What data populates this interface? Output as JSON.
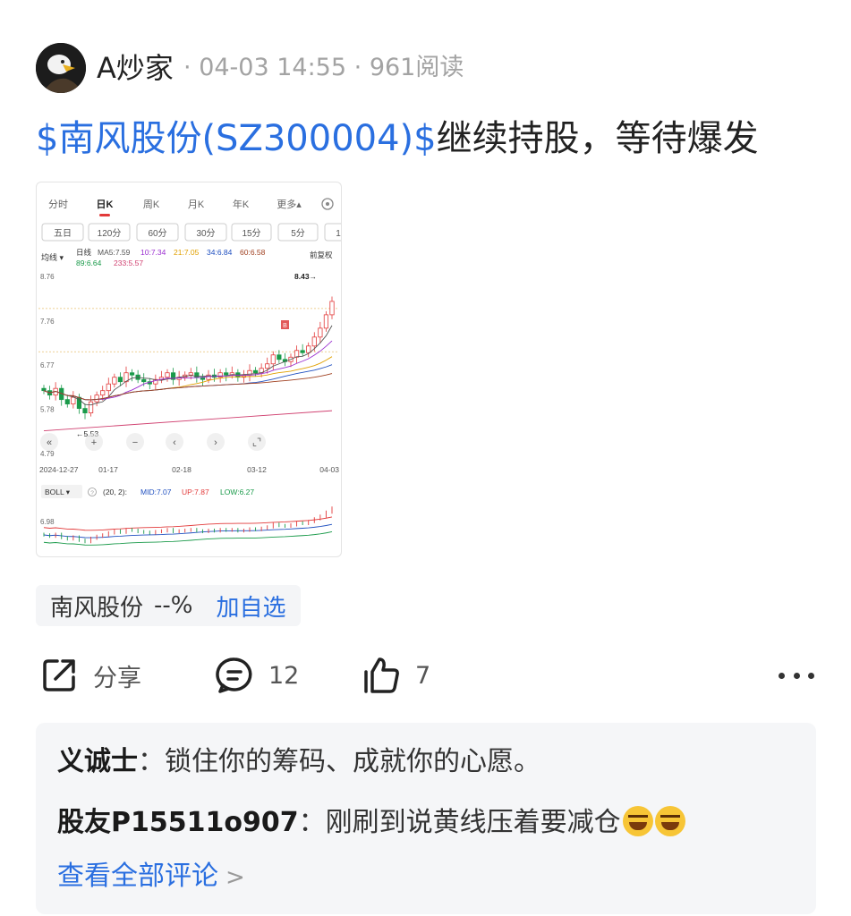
{
  "post": {
    "author": "A炒家",
    "date": "04-03 14:55",
    "reads": "961阅读",
    "separator": "·",
    "title_stock": "$南风股份(SZ300004)$",
    "title_rest": "继续持股，等待爆发"
  },
  "chart_card": {
    "tabs": [
      "分时",
      "日K",
      "周K",
      "月K",
      "年K",
      "更多▴"
    ],
    "active_tab": "日K",
    "periods": [
      "五日",
      "120分",
      "60分",
      "30分",
      "15分",
      "5分",
      "1"
    ],
    "indicator_label": "均线 ▾",
    "ma_labels": [
      {
        "text": "日线",
        "color": "#333333"
      },
      {
        "text": "MA5:7.59",
        "color": "#555555"
      },
      {
        "text": "10:7.34",
        "color": "#9b30d0"
      },
      {
        "text": "21:7.05",
        "color": "#e0a000"
      },
      {
        "text": "34:6.84",
        "color": "#2050c0"
      },
      {
        "text": "60:6.58",
        "color": "#a04020"
      },
      {
        "text": "89:6.64",
        "color": "#1a9a4a"
      },
      {
        "text": "233:5.57",
        "color": "#d04070"
      }
    ],
    "adjust_label": "前复权",
    "price_labels": [
      "8.76",
      "7.76",
      "6.77",
      "5.78",
      "4.79"
    ],
    "high_label": "8.43→",
    "low_label": "←5.53",
    "marker_b": "B",
    "date_labels": [
      "2024-12-27",
      "01-17",
      "02-18",
      "03-12",
      "04-03"
    ],
    "toolbar_icons": [
      "«",
      "+",
      "−",
      "‹",
      "›",
      "⌞⌝"
    ],
    "boll": {
      "name": "BOLL ▾",
      "help": "?",
      "params": "(20, 2):",
      "mid": "MID:7.07",
      "up": "UP:7.87",
      "low": "LOW:6.27",
      "axis_label": "6.98"
    },
    "colors": {
      "up": "#e23a3a",
      "down": "#1a9a4a",
      "dash": "#e8c070"
    }
  },
  "stock_tag": {
    "name": "南风股份",
    "change": "--%",
    "add_label": "加自选"
  },
  "actions": {
    "share_label": "分享",
    "comment_count": "12",
    "like_count": "7"
  },
  "comments": [
    {
      "user": "义诚士",
      "colon": "：",
      "text": "锁住你的筹码、成就你的心愿。"
    },
    {
      "user": "股友P15511o907",
      "colon": "：",
      "text": "刚刷到说黄线压着要减仓"
    }
  ],
  "view_all_label": "查看全部评论",
  "chart_data": {
    "type": "candlestick",
    "title": "",
    "period": "日K",
    "x_range": [
      "2024-12-27",
      "04-03"
    ],
    "ylim": [
      4.79,
      8.76
    ],
    "high": 8.43,
    "low": 5.53,
    "ma": {
      "MA5": 7.59,
      "MA10": 7.34,
      "MA21": 7.05,
      "MA34": 6.84,
      "MA60": 6.58,
      "MA89": 6.64,
      "MA233": 5.57
    },
    "closes": [
      6.2,
      6.1,
      6.25,
      6.0,
      5.9,
      6.05,
      5.8,
      5.7,
      5.95,
      6.1,
      6.2,
      6.35,
      6.5,
      6.4,
      6.6,
      6.55,
      6.45,
      6.4,
      6.35,
      6.45,
      6.5,
      6.6,
      6.45,
      6.5,
      6.55,
      6.6,
      6.5,
      6.45,
      6.55,
      6.5,
      6.6,
      6.55,
      6.6,
      6.5,
      6.55,
      6.65,
      6.6,
      6.7,
      6.8,
      7.0,
      6.9,
      6.85,
      6.95,
      7.1,
      7.05,
      7.2,
      7.4,
      7.6,
      7.9,
      8.2
    ],
    "boll": {
      "params": "(20, 2)",
      "MID": 7.07,
      "UP": 7.87,
      "LOW": 6.27
    }
  }
}
